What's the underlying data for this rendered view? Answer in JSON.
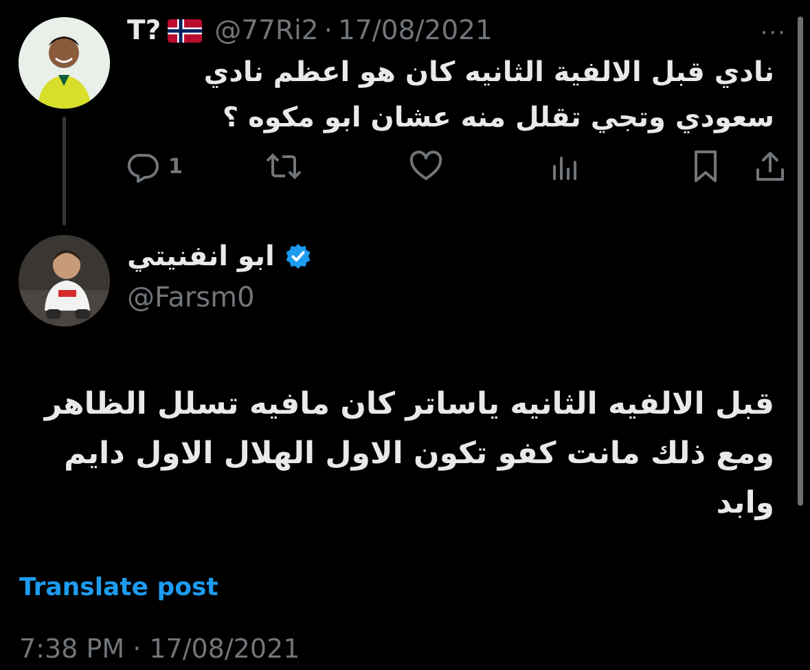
{
  "parent_tweet": {
    "display_name": "T?",
    "flag_icon": "norway-flag-icon",
    "handle": "@77Ri2",
    "separator": "·",
    "date": "17/08/2021",
    "text": "نادي قبل الالفية الثانيه كان هو اعظم نادي سعودي وتجي تقلل منه عشان ابو مكوه ؟",
    "more_label": "···",
    "actions": {
      "reply_count": "1",
      "reply_icon": "reply-icon",
      "retweet_icon": "retweet-icon",
      "like_icon": "heart-icon",
      "views_icon": "views-icon",
      "bookmark_icon": "bookmark-icon",
      "share_icon": "share-icon"
    }
  },
  "main_tweet": {
    "display_name": "ابو انفنيتي",
    "verified_icon": "verified-badge-icon",
    "handle": "@Farsm0",
    "text": "قبل الالفيه الثانيه ياساتر كان مافيه تسلل الظاهر ومع ذلك مانت كفو تكون الاول الهلال الاول دايم وابد",
    "translate_label": "Translate post",
    "timestamp": "7:38 PM · 17/08/2021"
  },
  "colors": {
    "background": "#000000",
    "text": "#e7e9ea",
    "muted": "#71767b",
    "link": "#1d9bf0",
    "verified": "#1d9bf0"
  }
}
